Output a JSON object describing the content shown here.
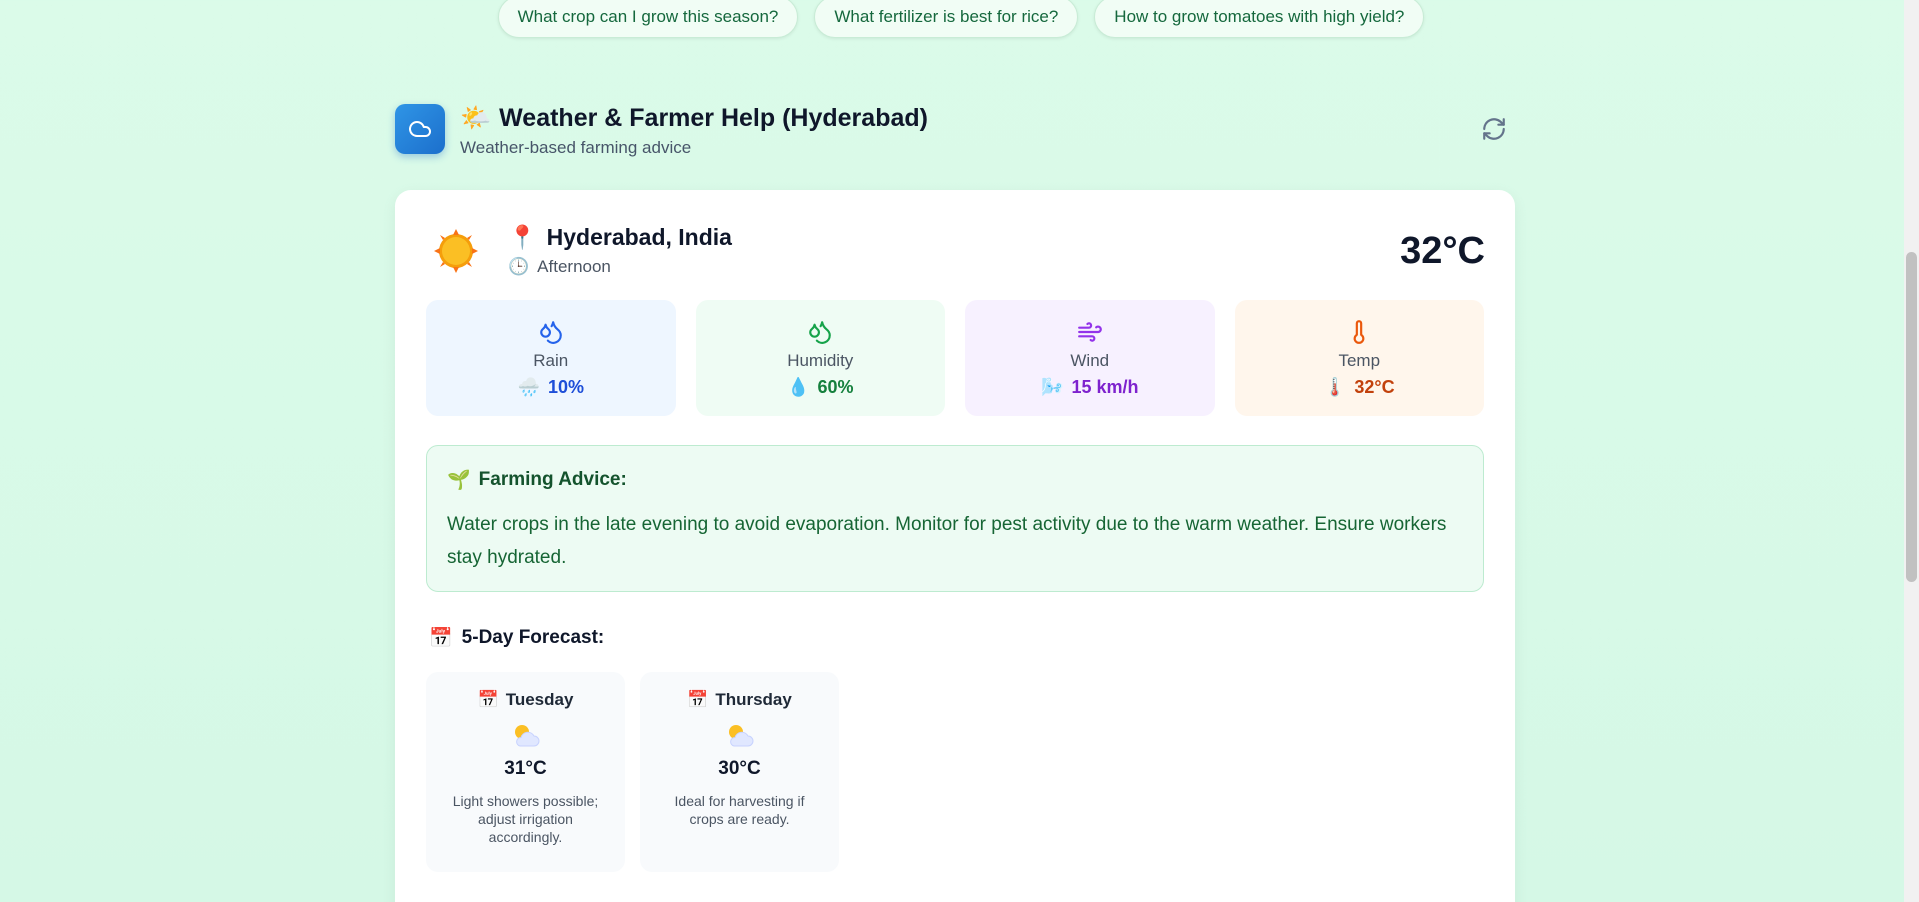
{
  "suggestions": [
    "What crop can I grow this season?",
    "What fertilizer is best for rice?",
    "How to grow tomatoes with high yield?"
  ],
  "header": {
    "title_emoji": "🌤️",
    "title": "Weather & Farmer Help (Hyderabad)",
    "subtitle": "Weather-based farming advice"
  },
  "location": {
    "pin_emoji": "📍",
    "name": "Hyderabad, India",
    "time_emoji": "🕒",
    "time_of_day": "Afternoon",
    "temperature": "32°C"
  },
  "stats": [
    {
      "label": "Rain",
      "emoji": "🌧️",
      "value": "10%"
    },
    {
      "label": "Humidity",
      "emoji": "💧",
      "value": "60%"
    },
    {
      "label": "Wind",
      "emoji": "🌬️",
      "value": "15 km/h"
    },
    {
      "label": "Temp",
      "emoji": "🌡️",
      "value": "32°C"
    }
  ],
  "advice": {
    "emoji": "🌱",
    "title": "Farming Advice:",
    "text": "Water crops in the late evening to avoid evaporation. Monitor for pest activity due to the warm weather. Ensure workers stay hydrated."
  },
  "forecast": {
    "emoji": "📅",
    "title": "5-Day Forecast:",
    "days": [
      {
        "day": "Tuesday",
        "emoji": "📅",
        "temp": "31°C",
        "note": "Light showers possible; adjust irrigation accordingly."
      },
      {
        "day": "Thursday",
        "emoji": "📅",
        "temp": "30°C",
        "note": "Ideal for harvesting if crops are ready."
      }
    ]
  },
  "colors": {
    "background": "#d8f9e7",
    "accent_blue": "#1d4ed8",
    "accent_green": "#15803d",
    "accent_purple": "#7e22ce",
    "accent_orange": "#c2410c"
  }
}
